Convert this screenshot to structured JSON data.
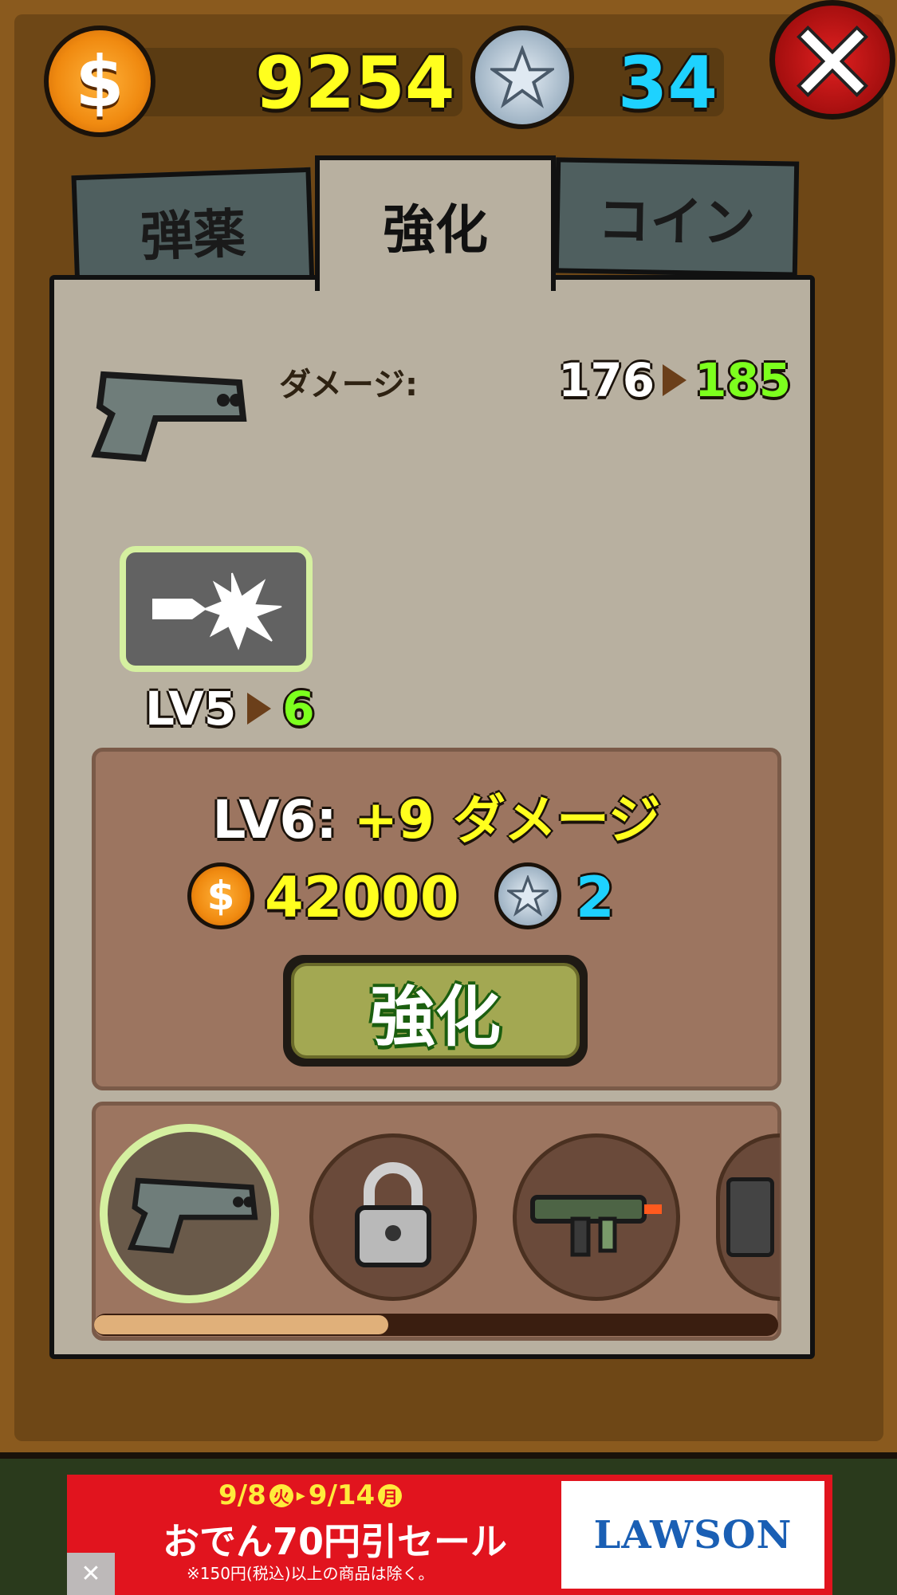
{
  "currency": {
    "coins": "9254",
    "stars": "34"
  },
  "icons": {
    "coin": "dollar-coin-icon",
    "star": "star-coin-icon",
    "close": "close-x-icon",
    "pistol": "pistol-icon",
    "bullet_hit": "bullet-impact-icon",
    "lock": "lock-icon"
  },
  "tabs": [
    {
      "label": "弾薬",
      "active": false
    },
    {
      "label": "強化",
      "active": true
    },
    {
      "label": "コイン",
      "active": false
    }
  ],
  "stat": {
    "label": "ダメージ:",
    "current": "176",
    "next": "185"
  },
  "skill": {
    "level_label": "LV5",
    "next_level": "6"
  },
  "upgrade": {
    "level_prefix": "LV6:",
    "bonus": "+9 ダメージ",
    "coin_cost": "42000",
    "star_cost": "2",
    "button_label": "強化"
  },
  "weapons": [
    {
      "name": "pistol",
      "selected": true,
      "locked": false
    },
    {
      "name": "knife-revolver",
      "selected": false,
      "locked": true
    },
    {
      "name": "smg",
      "selected": false,
      "locked": false
    },
    {
      "name": "heavy-gun",
      "selected": false,
      "locked": false
    }
  ],
  "weapon_scroll_fraction": 0.43,
  "ad": {
    "dates_start": "9/8",
    "dates_start_day": "火",
    "dates_end": "9/14",
    "dates_end_day": "月",
    "headline": "おでん70円引セール",
    "note": "※150円(税込)以上の商品は除く。",
    "brand": "LAWSON",
    "close_label": "✕"
  },
  "colors": {
    "coin_text": "#ffff1e",
    "star_text": "#1ed2ff",
    "upgrade_next": "#7dff1e",
    "ad_red": "#e1141e",
    "lawson_blue": "#1a5fb4"
  }
}
